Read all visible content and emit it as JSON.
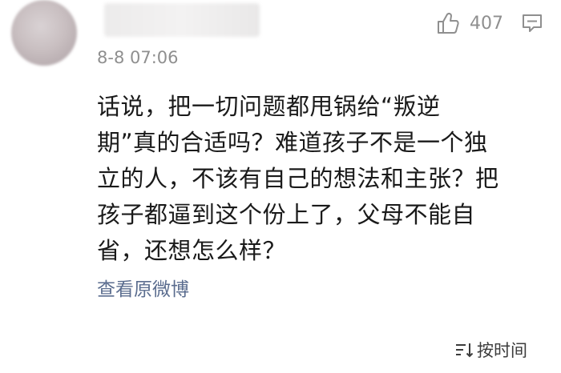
{
  "comment": {
    "username": "",
    "timestamp": "8-8 07:06",
    "like_count": "407",
    "content_lines": [
      "话说，把一切问题都甩锅给“叛逆",
      "期”真的合适吗？难道孩子不是一个独",
      "立的人，不该有自己的想法和主张？把",
      "孩子都逼到这个份上了，父母不能自",
      "省，还想怎么样？"
    ],
    "view_original_label": "查看原微博"
  },
  "sort": {
    "label": "按时间"
  },
  "icons": {
    "like": "thumbs-up-icon",
    "comment": "comment-icon",
    "sort": "sort-icon"
  },
  "colors": {
    "link": "#5b6d8f",
    "meta": "#8f8f8f",
    "text": "#1a1a1a"
  }
}
